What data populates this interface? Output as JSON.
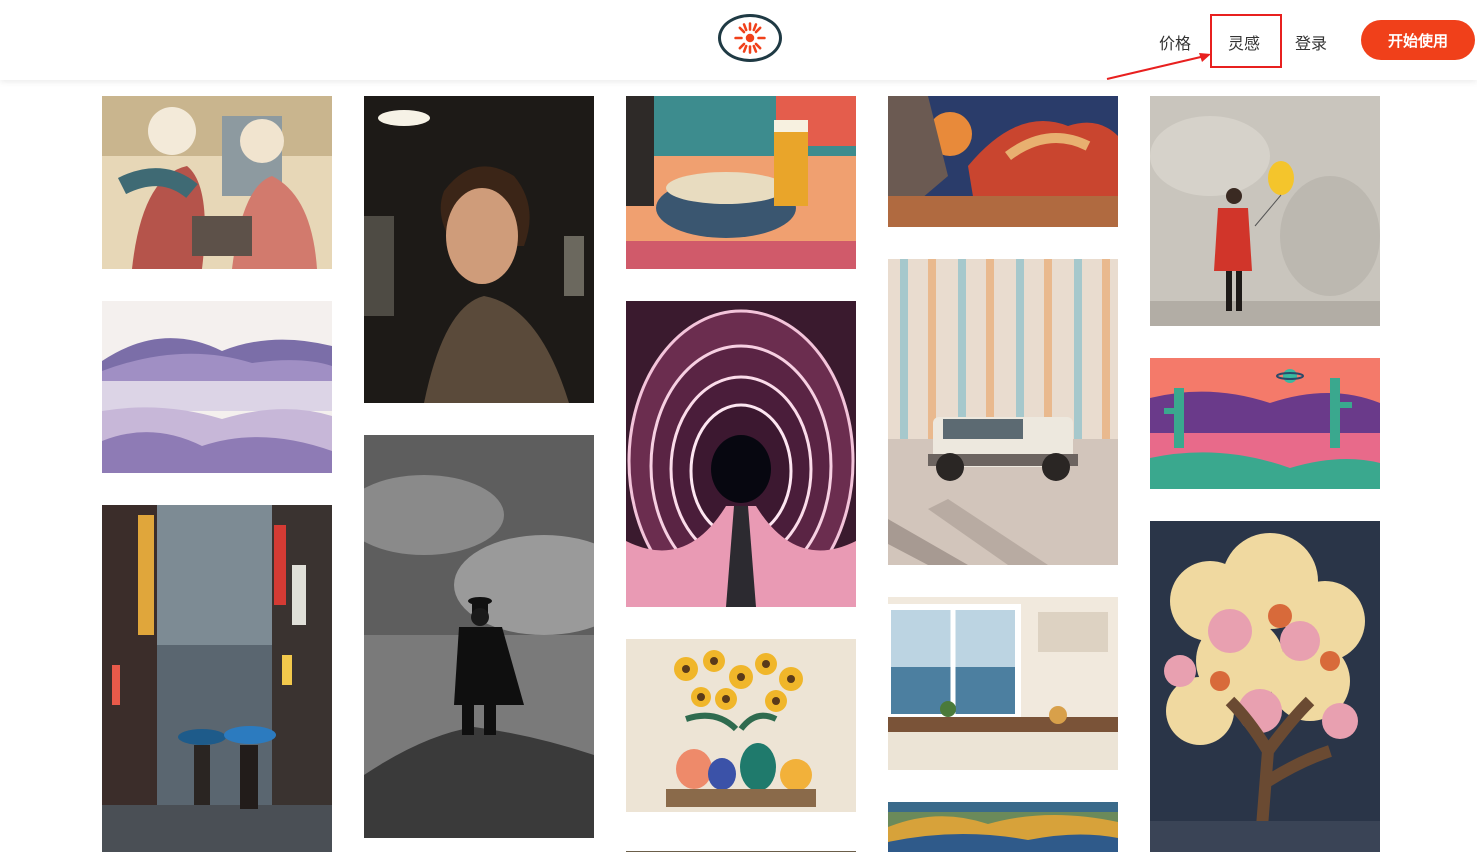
{
  "nav": {
    "price": "价格",
    "inspiration": "灵感",
    "login": "登录",
    "cta": "开始使用"
  },
  "colors": {
    "brand": "#f0401a",
    "logo_ring": "#1f3a44",
    "annotation": "#e8201f"
  },
  "gallery": [
    {
      "name": "comic-elderly-women"
    },
    {
      "name": "watercolor-mountain-lake"
    },
    {
      "name": "tokyo-rainy-street"
    },
    {
      "name": "woman-portrait"
    },
    {
      "name": "man-on-hill-bw"
    },
    {
      "name": "ramen-beer-popart"
    },
    {
      "name": "neon-tunnel"
    },
    {
      "name": "sunflowers-vases"
    },
    {
      "name": "partial-bottom-image"
    },
    {
      "name": "desert-planet-painting"
    },
    {
      "name": "vintage-suv-striped-wall"
    },
    {
      "name": "kitchen-ocean-view"
    },
    {
      "name": "great-wall-landscape"
    },
    {
      "name": "woman-yellow-balloon"
    },
    {
      "name": "retro-alien-desert"
    },
    {
      "name": "blossom-tree-night"
    }
  ]
}
